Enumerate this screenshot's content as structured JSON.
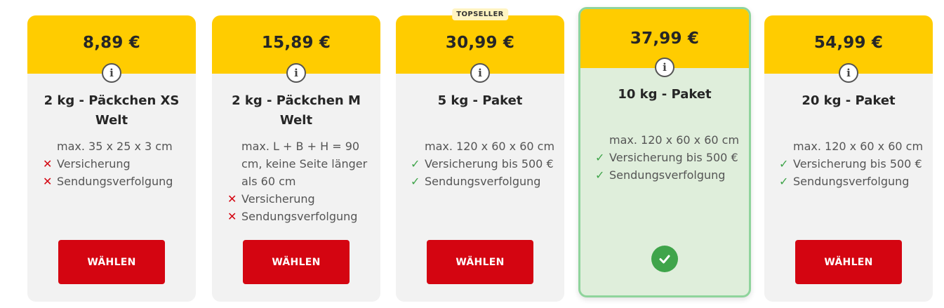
{
  "cards": [
    {
      "price": "8,89 €",
      "title": "2 kg - Päckchen XS Welt",
      "features": [
        {
          "mark": "",
          "text": "max. 35 x 25 x 3 cm"
        },
        {
          "mark": "✕",
          "text": "Versicherung"
        },
        {
          "mark": "✕",
          "text": "Sendungsverfolgung"
        }
      ],
      "button": "WÄHLEN"
    },
    {
      "price": "15,89 €",
      "title": "2 kg - Päckchen M Welt",
      "features": [
        {
          "mark": "",
          "text": "max. L + B + H = 90 cm, keine Seite länger als 60 cm"
        },
        {
          "mark": "✕",
          "text": "Versicherung"
        },
        {
          "mark": "✕",
          "text": "Sendungsverfolgung"
        }
      ],
      "button": "WÄHLEN"
    },
    {
      "badge": "TOPSELLER",
      "price": "30,99 €",
      "title": "5 kg - Paket",
      "features": [
        {
          "mark": "",
          "text": "max. 120 x 60 x 60 cm"
        },
        {
          "mark": "✓",
          "text": "Versicherung bis 500 €"
        },
        {
          "mark": "✓",
          "text": "Sendungsverfolgung"
        }
      ],
      "button": "WÄHLEN"
    },
    {
      "price": "37,99 €",
      "title": "10 kg - Paket",
      "selected": true,
      "features": [
        {
          "mark": "",
          "text": "max. 120 x 60 x 60 cm"
        },
        {
          "mark": "✓",
          "text": "Versicherung bis 500 €"
        },
        {
          "mark": "✓",
          "text": "Sendungsverfolgung"
        }
      ]
    },
    {
      "price": "54,99 €",
      "title": "20 kg - Paket",
      "features": [
        {
          "mark": "",
          "text": "max. 120 x 60 x 60 cm"
        },
        {
          "mark": "✓",
          "text": "Versicherung bis 500 €"
        },
        {
          "mark": "✓",
          "text": "Sendungsverfolgung"
        }
      ],
      "button": "WÄHLEN"
    }
  ],
  "info_icon_glyph": "i",
  "colors": {
    "header": "#ffcc00",
    "button": "#d40511",
    "cross": "#d40511",
    "check": "#3fa44a",
    "selected_bg": "#dfeedb",
    "selected_border": "#8fd49c"
  }
}
